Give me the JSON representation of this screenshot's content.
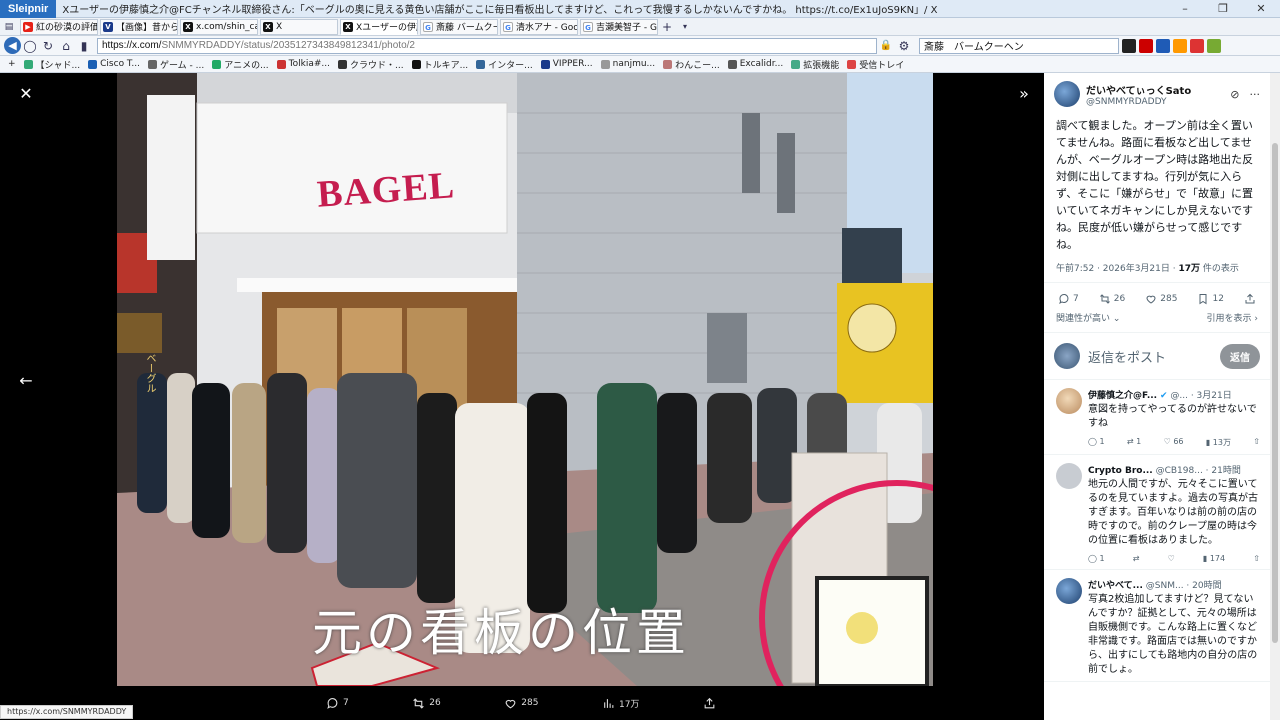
{
  "browser": {
    "app_name": "Sleipnir",
    "window_title": "Xユーザーの伊藤慎之介@FCチャンネル取締役さん:「ベーグルの奥に見える黄色い店舗がここに毎日看板出してますけど、これって我慢するしかないんですかね。 https://t.co/Ex1uJoS9KN」/ X",
    "tabs": [
      {
        "label": "紅の砂漠の評価..."
      },
      {
        "label": "【画像】昔から鳥..."
      },
      {
        "label": "x.com/shin_car..."
      },
      {
        "label": "X"
      },
      {
        "label": "Xユーザーの伊藤..."
      },
      {
        "label": "斎藤 バームクーヘ..."
      },
      {
        "label": "清水アナ - Goog..."
      },
      {
        "label": "吉瀬美智子 - G..."
      }
    ],
    "url_prefix": "https://x.com/",
    "url_rest": "SNMMYRDADDY/status/2035127343849812341/photo/2",
    "search_value": "斎藤　バームクーヘン",
    "bookmarks": [
      "【シャド...",
      "Cisco T...",
      "ゲーム - ...",
      "アニメの...",
      "Tolkia#...",
      "クラウド・...",
      "トルキア...",
      "インター...",
      "VIPPER...",
      "nanjmu...",
      "わんこー...",
      "Excalidr...",
      "拡張機能",
      "受信トレイ"
    ]
  },
  "viewer": {
    "caption": "元の看板の位置",
    "sign_text": "BAGEL",
    "shop_sign": "ベーグル",
    "actions": {
      "replies": "7",
      "reposts": "26",
      "likes": "285",
      "views": "17万"
    }
  },
  "post": {
    "author_name": "だいやべてぃっくSato",
    "author_handle": "@SNMMYRDADDY",
    "text": "調べて観ました。オープン前は全く置いてませんね。路面に看板など出してませんが、ベーグルオープン時は路地出た反対側に出してますね。行列が気に入らず、そこに「嫌がらせ」で「故意」に置いていてネガキャンにしか見えないですね。民度が低い嫌がらせって感じですね。",
    "time": "午前7:52 · 2026年3月21日 · ",
    "views": "17万",
    "views_suffix": " 件の表示",
    "stats": {
      "replies": "7",
      "reposts": "26",
      "likes": "285",
      "bookmarks": "12"
    },
    "relevance": "関連性が高い",
    "quote_link": "引用を表示",
    "reply_placeholder": "返信をポスト",
    "reply_button": "返信"
  },
  "comments": [
    {
      "name": "伊藤慎之介@F...",
      "handle": "@... · 3月21日",
      "text": "意図を持ってやってるのが許せないですね",
      "replies": "1",
      "reposts": "1",
      "likes": "66",
      "views": "13万"
    },
    {
      "name": "Crypto Bro...",
      "handle": "@CB198... · 21時間",
      "text": "地元の人間ですが、元々そこに置いてるのを見ていますよ。過去の写真が古すぎます。百年いなりは前の前の店の時ですので。前のクレープ屋の時は今の位置に看板はありました。",
      "replies": "1",
      "reposts": "",
      "likes": "",
      "views": "174"
    },
    {
      "name": "だいやべて...",
      "handle": "@SNM... · 20時間",
      "text": "写真2枚追加してますけど？見てないんですか？証拠として、元々の場所は自販機側です。こんな路上に置くなど非常識です。路面店では無いのですから、出すにしても路地内の自分の店の前でしょ。",
      "replies": "",
      "reposts": "",
      "likes": "",
      "views": ""
    }
  ],
  "status_url": "https://x.com/SNMMYRDADDY"
}
